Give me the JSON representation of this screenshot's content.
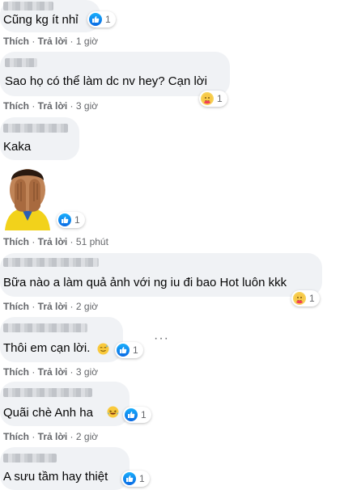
{
  "actions": {
    "like": "Thích",
    "reply": "Trả lời"
  },
  "comments": [
    {
      "text": "Cũng kg ít nhỉ",
      "time": "1 giờ",
      "reaction": "like",
      "reaction_count": "1"
    },
    {
      "text": "Sao họ có thể làm dc nv hey? Cạn lời",
      "time": "3 giờ",
      "reaction": "care",
      "reaction_count": "1"
    },
    {
      "text": "Kaka",
      "time": "51 phút",
      "reaction": "like",
      "reaction_count": "1",
      "sticker": "face-palm-sticker"
    },
    {
      "text": "Bữa nào a làm quả ảnh với ng iu đi bao Hot luôn kkk",
      "time": "2 giờ",
      "reaction": "care",
      "reaction_count": "1"
    },
    {
      "text": "Thôi em cạn lời.",
      "time": "3 giờ",
      "reaction": "like",
      "reaction_count": "1",
      "emoji": "sweat-smile-emoji"
    },
    {
      "text": "Quãi chè Anh ha",
      "time": "2 giờ",
      "reaction": "like",
      "reaction_count": "1",
      "emoji": "laughing-emoji"
    },
    {
      "text": "A sưu tầm hay thiệt",
      "reaction": "like",
      "reaction_count": "1"
    }
  ],
  "more_options": "···",
  "colors": {
    "bubble": "#f0f2f5",
    "meta_text": "#65676b",
    "like_blue": "#1877f2"
  }
}
